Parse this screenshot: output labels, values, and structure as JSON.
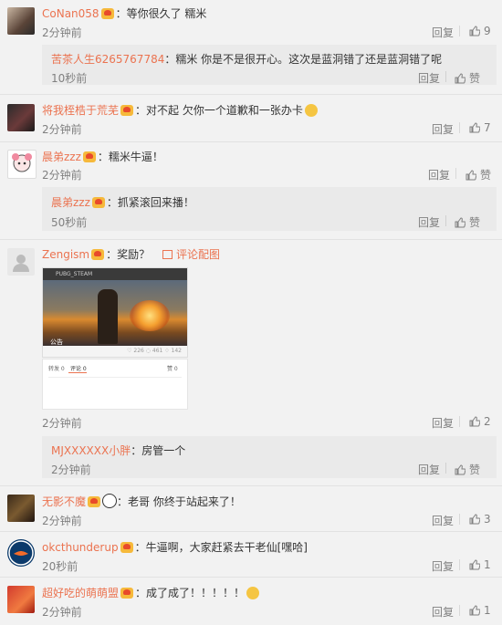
{
  "labels": {
    "reply": "回复",
    "like": "赞"
  },
  "comments": [
    {
      "user": "CoNan058",
      "text": "：等你很久了 糯米",
      "time": "2分钟前",
      "likes": "9",
      "reply": {
        "user": "苦茶人生6265767784",
        "text": "：糯米 你是不是很开心。这次是蓝洞错了还是蓝洞错了呢",
        "time": "10秒前"
      }
    },
    {
      "user": "将我桎梏于荒芜",
      "text": "：对不起 欠你一个道歉和一张办卡",
      "time": "2分钟前",
      "likes": "7"
    },
    {
      "user": "晨弟zzz",
      "text": "：糯米牛逼！",
      "time": "2分钟前",
      "reply": {
        "user": "晨弟zzz",
        "text": "：抓紧滚回来播！",
        "time": "50秒前"
      }
    },
    {
      "user": "Zengism",
      "text": "：奖励？",
      "image_link": "评论配图",
      "time": "2分钟前",
      "likes": "2",
      "image": {
        "bar": "PUBG_STEAM",
        "gong": "公告",
        "stats": "♡ 226  ◌ 461  ♢ 142",
        "tab1": "转发 0",
        "tab2": "评论 0",
        "tab3": "赞 0"
      },
      "reply": {
        "user": "MJXXXXXX小胖",
        "text": "：房管一个",
        "time": "2分钟前"
      }
    },
    {
      "user": "无影不魔",
      "text": "：老哥 你终于站起来了！",
      "time": "2分钟前",
      "likes": "3"
    },
    {
      "user": "okcthunderup",
      "text": "：牛逼啊，大家赶紧去干老仙[嘿哈]",
      "time": "20秒前",
      "likes": "1"
    },
    {
      "user": "超好吃的萌萌盟",
      "text": "：成了成了！！！！！",
      "time": "2分钟前",
      "likes": "1"
    }
  ],
  "colors": {
    "username": "#eb7350",
    "meta": "#808080",
    "background": "#f2f2f2",
    "reply_box": "#eaeaea"
  }
}
